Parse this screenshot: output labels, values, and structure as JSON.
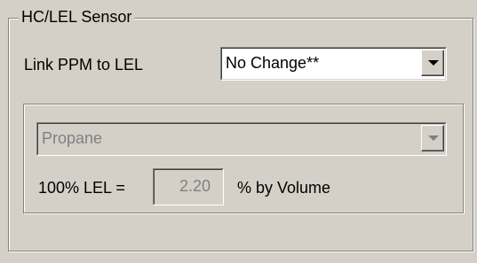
{
  "group": {
    "title": "HC/LEL Sensor"
  },
  "link_ppm": {
    "label": "Link PPM to LEL",
    "selected": "No Change**"
  },
  "gas": {
    "selected": "Propane"
  },
  "lel": {
    "label": "100% LEL =",
    "value": "2.20",
    "unit": "% by Volume"
  },
  "colors": {
    "background": "#d4d0c8",
    "disabled_text": "#808080"
  }
}
